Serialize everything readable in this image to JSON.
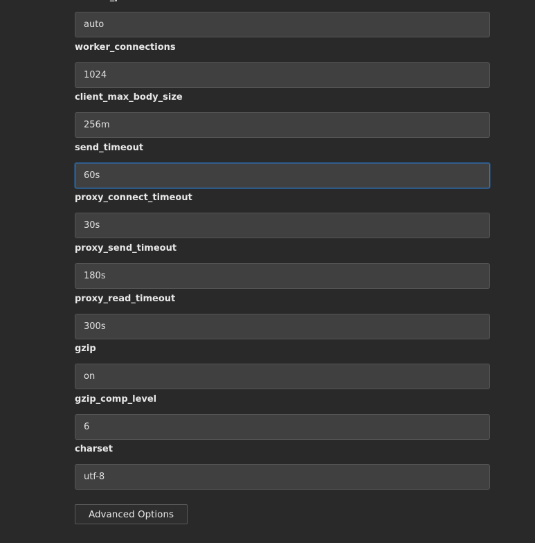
{
  "fields": [
    {
      "label": "worker_processes",
      "value": "auto"
    },
    {
      "label": "worker_connections",
      "value": "1024"
    },
    {
      "label": "client_max_body_size",
      "value": "256m"
    },
    {
      "label": "send_timeout",
      "value": "60s",
      "focused": true
    },
    {
      "label": "proxy_connect_timeout",
      "value": "30s"
    },
    {
      "label": "proxy_send_timeout",
      "value": "180s"
    },
    {
      "label": "proxy_read_timeout",
      "value": "300s"
    },
    {
      "label": "gzip",
      "value": "on"
    },
    {
      "label": "gzip_comp_level",
      "value": "6"
    },
    {
      "label": "charset",
      "value": "utf-8"
    }
  ],
  "advanced_button": {
    "label": "Advanced Options"
  },
  "colors": {
    "background": "#292929",
    "input_background": "#404040",
    "focus_border": "#2b7fd4"
  }
}
